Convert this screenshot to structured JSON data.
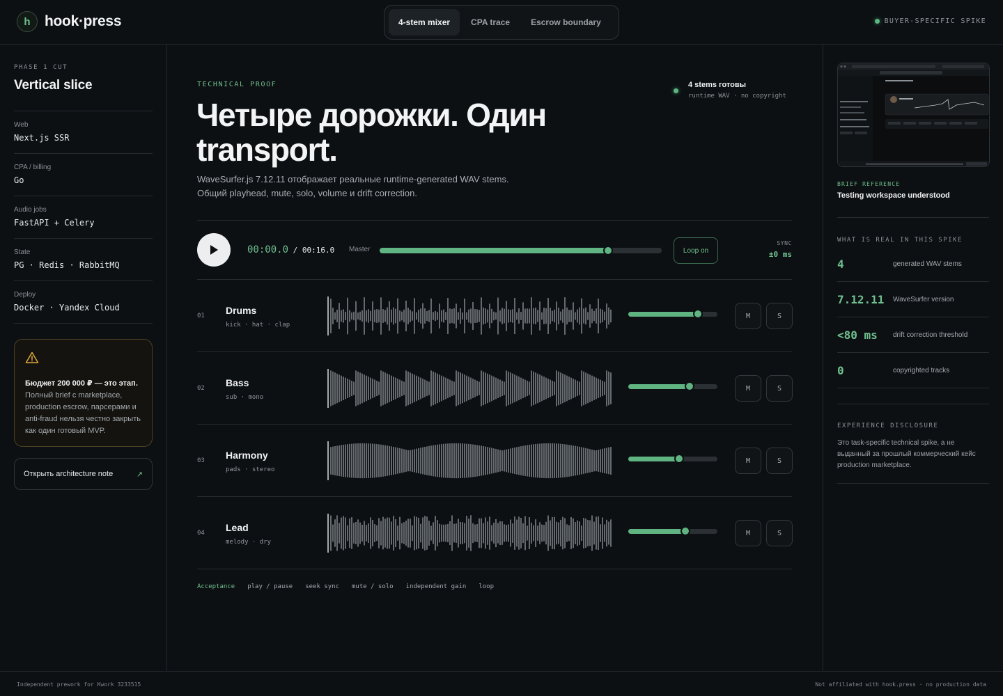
{
  "brand": {
    "logo_letter": "h",
    "name": "hook·press"
  },
  "nav": {
    "tabs": [
      {
        "label": "4-stem mixer",
        "active": true
      },
      {
        "label": "CPA trace",
        "active": false
      },
      {
        "label": "Escrow boundary",
        "active": false
      }
    ],
    "badge": "BUYER-SPECIFIC SPIKE"
  },
  "sidebar": {
    "phase_label": "PHASE 1 CUT",
    "title": "Vertical slice",
    "stack": [
      {
        "key": "Web",
        "value": "Next.js SSR"
      },
      {
        "key": "CPA / billing",
        "value": "Go"
      },
      {
        "key": "Audio jobs",
        "value": "FastAPI + Celery"
      },
      {
        "key": "State",
        "value": "PG · Redis · RabbitMQ"
      },
      {
        "key": "Deploy",
        "value": "Docker · Yandex Cloud"
      }
    ],
    "warning": {
      "bold": "Бюджет 200 000 ₽ — это этап.",
      "text": " Полный brief с marketplace, production escrow, парсерами и anti-fraud нельзя честно закрыть как один готовый MVP."
    },
    "arch_button": {
      "label": "Открыть architecture note",
      "arrow": "↗"
    }
  },
  "main": {
    "eyebrow": "TECHNICAL PROOF",
    "headline_line1": "Четыре дорожки. Один",
    "headline_line2": "transport.",
    "lead_line1": "WaveSurfer.js 7.12.11 отображает реальные runtime-generated WAV stems.",
    "lead_line2": "Общий playhead, mute, solo, volume и drift correction.",
    "status": {
      "title": "4 stems готовы",
      "sub": "runtime WAV · no copyright"
    },
    "transport": {
      "current_time": "00:00.0",
      "separator": " / ",
      "duration": "00:16.0",
      "master_label": "Master",
      "master_level": 0.81,
      "loop_label": "Loop on",
      "sync_label": "SYNC",
      "sync_value": "±0 ms"
    },
    "tracks": [
      {
        "num": "01",
        "name": "Drums",
        "sub": "kick · hat · clap",
        "volume": 0.78,
        "mute": "M",
        "solo": "S",
        "pattern": "drums"
      },
      {
        "num": "02",
        "name": "Bass",
        "sub": "sub · mono",
        "volume": 0.69,
        "mute": "M",
        "solo": "S",
        "pattern": "bass"
      },
      {
        "num": "03",
        "name": "Harmony",
        "sub": "pads · stereo",
        "volume": 0.57,
        "mute": "M",
        "solo": "S",
        "pattern": "harmony"
      },
      {
        "num": "04",
        "name": "Lead",
        "sub": "melody · dry",
        "volume": 0.64,
        "mute": "M",
        "solo": "S",
        "pattern": "lead"
      }
    ],
    "acceptance": {
      "title": "Acceptance",
      "items": [
        "play / pause",
        "seek sync",
        "mute / solo",
        "independent gain",
        "loop"
      ]
    }
  },
  "right": {
    "ref_eyebrow": "BRIEF REFERENCE",
    "ref_title": "Testing workspace understood",
    "real_label": "WHAT IS REAL IN THIS SPIKE",
    "metrics": [
      {
        "value": "4",
        "label": "generated WAV stems"
      },
      {
        "value": "7.12.11",
        "label": "WaveSurfer version"
      },
      {
        "value": "<80 ms",
        "label": "drift correction threshold"
      },
      {
        "value": "0",
        "label": "copyrighted tracks"
      }
    ],
    "disclosure_label": "EXPERIENCE DISCLOSURE",
    "disclosure_text": "Это task-specific technical spike, а не выданный за прошлый коммерческий кейс production marketplace."
  },
  "footer": {
    "left": "Independent prework for Kwork 3233515",
    "right": "Not affiliated with hook.press · no production data"
  },
  "colors": {
    "accent": "#5fb482",
    "background": "#0d1013",
    "wave": "#8a9196",
    "warning_border": "#4b4023"
  }
}
